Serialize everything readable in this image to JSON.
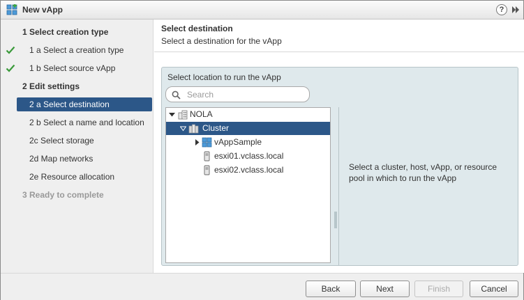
{
  "window": {
    "title": "New vApp",
    "app_icon": "vapp-icon",
    "help_icon": "help-icon",
    "expand_icon": "expand-icon"
  },
  "steps": [
    {
      "label": "1  Select creation type",
      "level": "group",
      "state": "done"
    },
    {
      "label": "1 a  Select a creation type",
      "level": "sub",
      "state": "done",
      "check": true
    },
    {
      "label": "1 b  Select source vApp",
      "level": "sub",
      "state": "done",
      "check": true
    },
    {
      "label": "2  Edit settings",
      "level": "group",
      "state": "current"
    },
    {
      "label": "2 a  Select destination",
      "level": "sub",
      "state": "active"
    },
    {
      "label": "2 b  Select a name and location",
      "level": "sub",
      "state": "pending"
    },
    {
      "label": "2c  Select storage",
      "level": "sub",
      "state": "pending"
    },
    {
      "label": "2d  Map networks",
      "level": "sub",
      "state": "pending"
    },
    {
      "label": "2e  Resource allocation",
      "level": "sub",
      "state": "pending"
    },
    {
      "label": "3  Ready to complete",
      "level": "group",
      "state": "disabled"
    }
  ],
  "header": {
    "title": "Select destination",
    "subtitle": "Select a destination for the vApp"
  },
  "panel": {
    "label": "Select location to run the vApp",
    "search": {
      "placeholder": "Search",
      "value": ""
    },
    "tree": [
      {
        "label": "NOLA",
        "icon": "datacenter-icon",
        "expanded": true,
        "level": 0
      },
      {
        "label": "Cluster",
        "icon": "cluster-icon",
        "expanded": true,
        "level": 1,
        "selected": true
      },
      {
        "label": "vAppSample",
        "icon": "vapp-icon",
        "expanded": false,
        "level": 2
      },
      {
        "label": "esxi01.vclass.local",
        "icon": "host-icon",
        "level": 2
      },
      {
        "label": "esxi02.vclass.local",
        "icon": "host-icon",
        "level": 2
      }
    ],
    "hint": "Select a cluster, host, vApp, or resource pool in which to run the vApp"
  },
  "footer": {
    "back": "Back",
    "next": "Next",
    "finish": "Finish",
    "cancel": "Cancel"
  },
  "colors": {
    "accent": "#2c5788",
    "check": "#3a9a3a",
    "panel_bg": "#dfe9ec"
  }
}
